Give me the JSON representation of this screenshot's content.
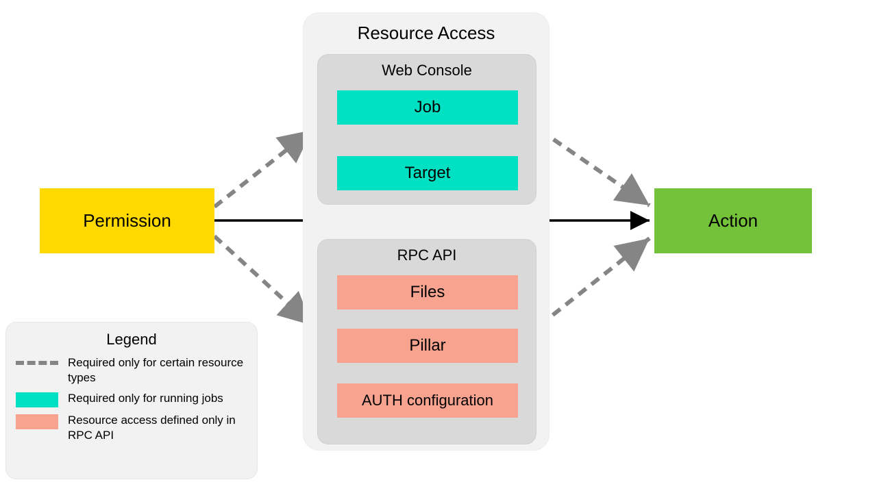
{
  "nodes": {
    "permission": "Permission",
    "action": "Action"
  },
  "resource_access": {
    "title": "Resource Access",
    "web_console": {
      "title": "Web Console",
      "items": [
        "Job",
        "Target"
      ]
    },
    "rpc_api": {
      "title": "RPC API",
      "items": [
        "Files",
        "Pillar",
        "AUTH configuration"
      ]
    }
  },
  "legend": {
    "title": "Legend",
    "items": [
      {
        "type": "dashed",
        "text": "Required only for certain resource types"
      },
      {
        "type": "teal",
        "text": "Required only for running jobs"
      },
      {
        "type": "coral",
        "text": "Resource access defined only in RPC API"
      }
    ]
  },
  "colors": {
    "permission_bg": "#ffd900",
    "action_bg": "#74c13a",
    "panel_bg": "#d9d9d9",
    "container_bg": "#f2f2f2",
    "teal": "#00e0c2",
    "coral": "#f7a390",
    "dashed_arrow": "#858585",
    "solid_arrow": "#000000"
  }
}
